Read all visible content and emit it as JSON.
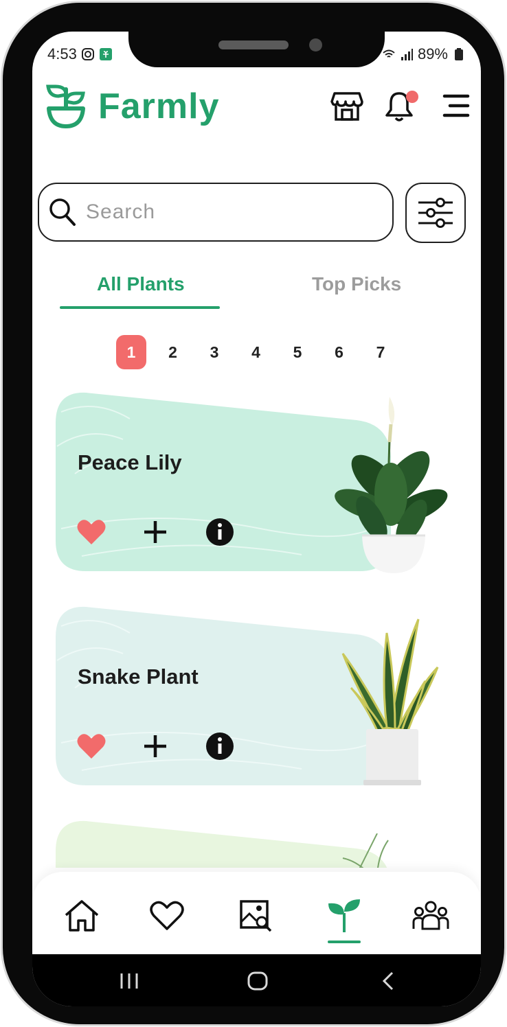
{
  "status_bar": {
    "time": "4:53",
    "battery": "89%"
  },
  "app": {
    "name": "Farmly"
  },
  "search": {
    "placeholder": "Search"
  },
  "tabs": [
    {
      "label": "All Plants",
      "active": true
    },
    {
      "label": "Top Picks",
      "active": false
    }
  ],
  "pagination": {
    "pages": [
      "1",
      "2",
      "3",
      "4",
      "5",
      "6",
      "7"
    ],
    "current": "1"
  },
  "plants": [
    {
      "name": "Peace Lily",
      "card_color": "#c9efe0"
    },
    {
      "name": "Snake Plant",
      "card_color": "#dff1ee"
    },
    {
      "name": "",
      "card_color": "#e8f6df"
    }
  ],
  "colors": {
    "brand": "#24a06b",
    "accent": "#f26b6b",
    "heart": "#f26b6b"
  },
  "icons": {
    "header": [
      "store-icon",
      "bell-icon",
      "menu-icon"
    ],
    "bottom_nav": [
      "home-icon",
      "heart-icon",
      "image-search-icon",
      "sprout-icon",
      "community-icon"
    ],
    "system_nav": [
      "recent-apps-icon",
      "home-circle-icon",
      "back-icon"
    ]
  }
}
